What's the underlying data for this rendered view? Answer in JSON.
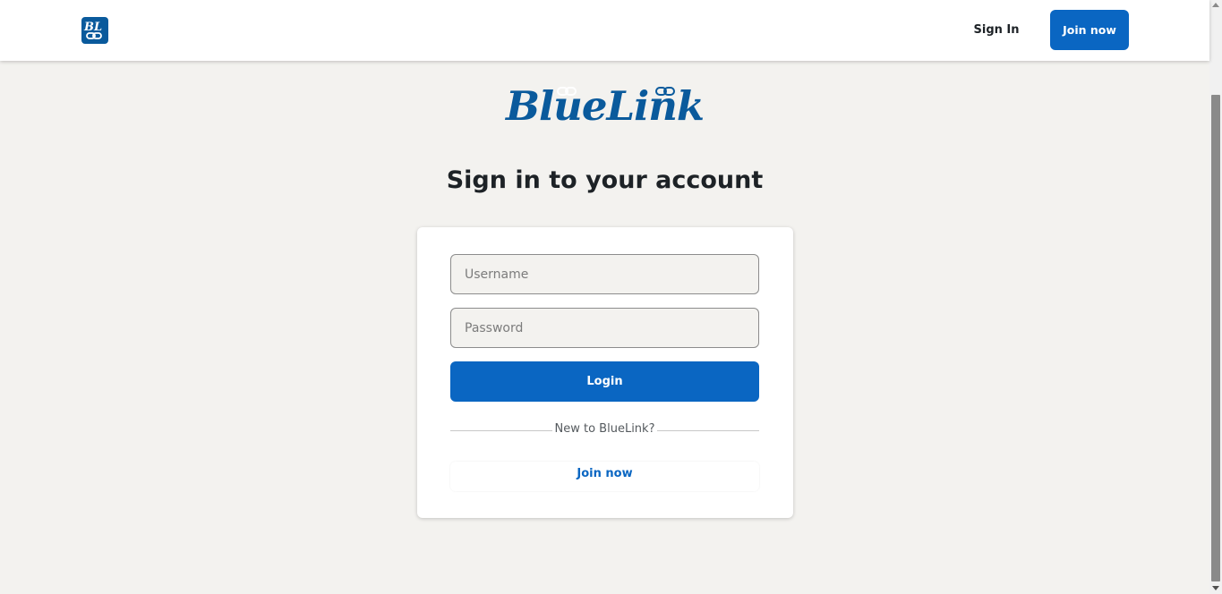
{
  "header": {
    "badge_letters": "BL",
    "signin_label": "Sign In",
    "join_label": "Join now"
  },
  "logo": {
    "text": "BlueLink"
  },
  "heading": "Sign in to your account",
  "form": {
    "username_placeholder": "Username",
    "password_placeholder": "Password",
    "login_label": "Login",
    "divider_text": "New to BlueLink?",
    "join_label": "Join now"
  },
  "colors": {
    "brand": "#0a5a9c",
    "primary": "#0a66c2",
    "background": "#f3f2ef"
  }
}
